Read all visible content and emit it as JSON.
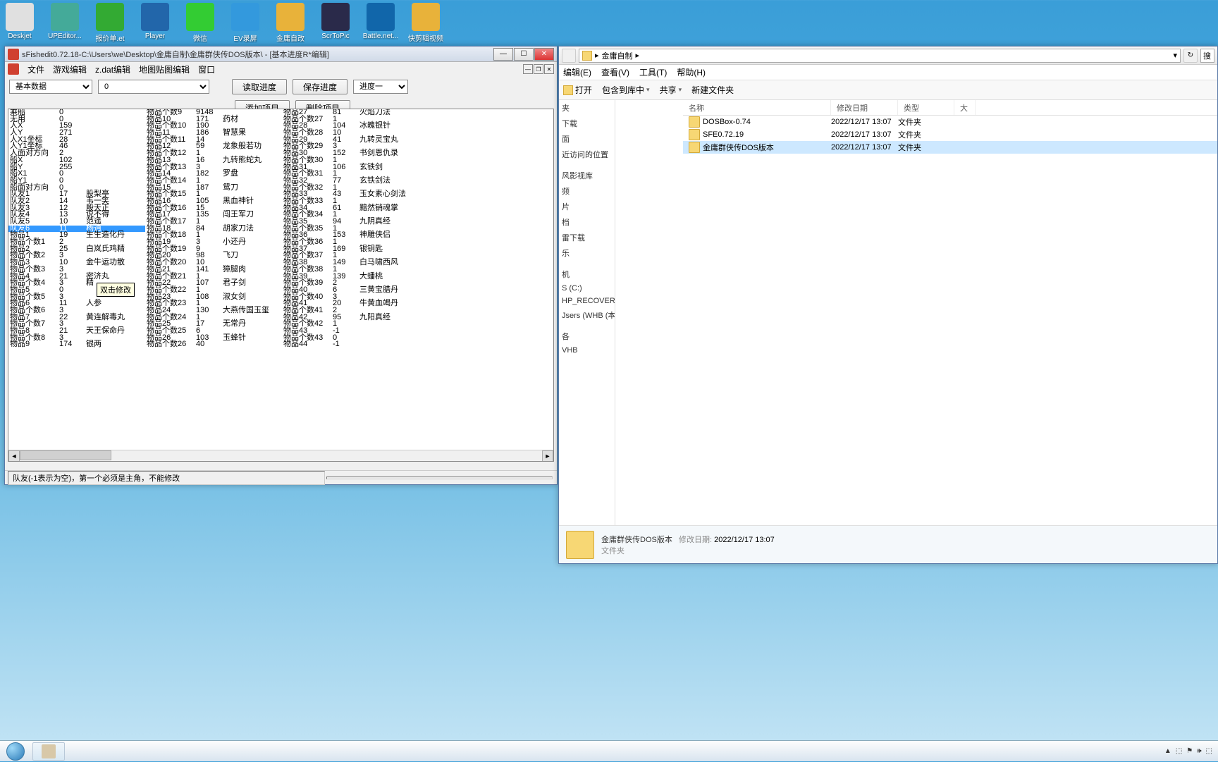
{
  "desktop": {
    "icons": [
      {
        "label": "Deskjet",
        "color": "#e0e0e0"
      },
      {
        "label": "UPEditor...",
        "color": "#4a9"
      },
      {
        "label": "报价单.et",
        "color": "#3a3"
      },
      {
        "label": "Player",
        "color": "#26a"
      },
      {
        "label": "微信",
        "color": "#3c3"
      },
      {
        "label": "EV录屏",
        "color": "#39d"
      },
      {
        "label": "金庸自改",
        "color": "#e8b23a"
      },
      {
        "label": "ScrToPic",
        "color": "#2a2a4a"
      },
      {
        "label": "Battle.net...",
        "color": "#16a"
      },
      {
        "label": "快剪辑视频",
        "color": "#e8b23a"
      }
    ]
  },
  "editor": {
    "title": "sFishedit0.72.18-C:\\Users\\we\\Desktop\\金庸自制\\金庸群侠传DOS版本\\ - [基本进度R*编辑]",
    "menu": [
      "文件",
      "游戏编辑",
      "z.dat编辑",
      "地图贴图编辑",
      "窗口"
    ],
    "combo1": "基本数据",
    "combo2": "0",
    "btn_read": "读取进度",
    "btn_save": "保存进度",
    "combo_progress": "进度一",
    "btn_add": "添加项目",
    "btn_del": "删除项目",
    "status": "队友(-1表示为空)，第一个必须是主角，不能修改",
    "tooltip": "双击修改",
    "columns": {
      "g1": [
        {
          "l": "乘船",
          "v": "0"
        },
        {
          "l": "无用",
          "v": "0"
        },
        {
          "l": "人X",
          "v": "159"
        },
        {
          "l": "人Y",
          "v": "271"
        },
        {
          "l": "人X1坐标",
          "v": "28"
        },
        {
          "l": "人Y1坐标",
          "v": "46"
        },
        {
          "l": "人面对方向",
          "v": "2"
        },
        {
          "l": "船X",
          "v": "102"
        },
        {
          "l": "船Y",
          "v": "255"
        },
        {
          "l": "船X1",
          "v": "0"
        },
        {
          "l": "船Y1",
          "v": "0"
        },
        {
          "l": "船面对方向",
          "v": "0"
        },
        {
          "l": "队友1",
          "v": "17",
          "n": "股梨亭"
        },
        {
          "l": "队友2",
          "v": "14",
          "n": "韦一笑"
        },
        {
          "l": "队友3",
          "v": "12",
          "n": "殷天正"
        },
        {
          "l": "队友4",
          "v": "13",
          "n": "说不得"
        },
        {
          "l": "队友5",
          "v": "10",
          "n": "范遥"
        },
        {
          "l": "队友6",
          "v": "11",
          "n": "杨逍",
          "sel": true
        },
        {
          "l": "物品1",
          "v": "19",
          "n": "生生造化丹"
        },
        {
          "l": "物品个数1",
          "v": "2"
        },
        {
          "l": "物品2",
          "v": "25",
          "n": "白岚氏鸡精"
        },
        {
          "l": "物品个数2",
          "v": "3"
        },
        {
          "l": "物品3",
          "v": "10",
          "n": "金牛运功散"
        },
        {
          "l": "物品个数3",
          "v": "3"
        },
        {
          "l": "物品4",
          "v": "21",
          "n": "密济丸"
        },
        {
          "l": "物品个数4",
          "v": "3",
          "n": "精"
        },
        {
          "l": "物品5",
          "v": "0"
        },
        {
          "l": "物品个数5",
          "v": "3"
        },
        {
          "l": "物品6",
          "v": "11",
          "n": "人参"
        },
        {
          "l": "物品个数6",
          "v": "3"
        },
        {
          "l": "物品7",
          "v": "22",
          "n": "黄连解毒丸"
        },
        {
          "l": "物品个数7",
          "v": "3"
        },
        {
          "l": "物品8",
          "v": "21",
          "n": "天王保命丹"
        },
        {
          "l": "物品个数8",
          "v": "3"
        },
        {
          "l": "物品9",
          "v": "174",
          "n": "银两"
        }
      ],
      "g2": [
        {
          "l": "物品个数9",
          "v": "9148"
        },
        {
          "l": "物品10",
          "v": "171",
          "n": "药材"
        },
        {
          "l": "物品个数10",
          "v": "190"
        },
        {
          "l": "物品11",
          "v": "186",
          "n": "智慧果"
        },
        {
          "l": "物品个数11",
          "v": "14"
        },
        {
          "l": "物品12",
          "v": "59",
          "n": "龙象般若功"
        },
        {
          "l": "物品个数12",
          "v": "1"
        },
        {
          "l": "物品13",
          "v": "16",
          "n": "九转熊蛇丸"
        },
        {
          "l": "物品个数13",
          "v": "3"
        },
        {
          "l": "物品14",
          "v": "182",
          "n": "罗盘"
        },
        {
          "l": "物品个数14",
          "v": "1"
        },
        {
          "l": "物品15",
          "v": "187",
          "n": "鸳刀"
        },
        {
          "l": "物品个数15",
          "v": "1"
        },
        {
          "l": "物品16",
          "v": "105",
          "n": "黑血神针"
        },
        {
          "l": "物品个数16",
          "v": "15"
        },
        {
          "l": "物品17",
          "v": "135",
          "n": "闯王军刀"
        },
        {
          "l": "物品个数17",
          "v": "1"
        },
        {
          "l": "物品18",
          "v": "84",
          "n": "胡家刀法"
        },
        {
          "l": "物品个数18",
          "v": "1"
        },
        {
          "l": "物品19",
          "v": "3",
          "n": "小还丹"
        },
        {
          "l": "物品个数19",
          "v": "9"
        },
        {
          "l": "物品20",
          "v": "98",
          "n": "飞刀"
        },
        {
          "l": "物品个数20",
          "v": "10"
        },
        {
          "l": "物品21",
          "v": "141",
          "n": "獐腿肉"
        },
        {
          "l": "物品个数21",
          "v": "1"
        },
        {
          "l": "物品22",
          "v": "107",
          "n": "君子剑"
        },
        {
          "l": "物品个数22",
          "v": "1"
        },
        {
          "l": "物品23",
          "v": "108",
          "n": "淑女剑"
        },
        {
          "l": "物品个数23",
          "v": "1"
        },
        {
          "l": "物品24",
          "v": "130",
          "n": "大燕传国玉玺"
        },
        {
          "l": "物品个数24",
          "v": "1"
        },
        {
          "l": "物品25",
          "v": "17",
          "n": "无常丹"
        },
        {
          "l": "物品个数25",
          "v": "6"
        },
        {
          "l": "物品26",
          "v": "103",
          "n": "玉蜂针"
        },
        {
          "l": "物品个数26",
          "v": "40"
        }
      ],
      "g3": [
        {
          "l": "物品27",
          "v": "81",
          "n": "火焰刀法"
        },
        {
          "l": "物品个数27",
          "v": "1"
        },
        {
          "l": "物品28",
          "v": "104",
          "n": "冰魄银针"
        },
        {
          "l": "物品个数28",
          "v": "10"
        },
        {
          "l": "物品29",
          "v": "41",
          "n": "九转灵宝丸"
        },
        {
          "l": "物品个数29",
          "v": "3"
        },
        {
          "l": "物品30",
          "v": "152",
          "n": "书剑恩仇录"
        },
        {
          "l": "物品个数30",
          "v": "1"
        },
        {
          "l": "物品31",
          "v": "106",
          "n": "玄铁剑"
        },
        {
          "l": "物品个数31",
          "v": "1"
        },
        {
          "l": "物品32",
          "v": "77",
          "n": "玄铁剑法"
        },
        {
          "l": "物品个数32",
          "v": "1"
        },
        {
          "l": "物品33",
          "v": "43",
          "n": "玉女素心剑法"
        },
        {
          "l": "物品个数33",
          "v": "1"
        },
        {
          "l": "物品34",
          "v": "61",
          "n": "黯然销魂掌"
        },
        {
          "l": "物品个数34",
          "v": "1"
        },
        {
          "l": "物品35",
          "v": "94",
          "n": "九阴真经"
        },
        {
          "l": "物品个数35",
          "v": "1"
        },
        {
          "l": "物品36",
          "v": "153",
          "n": "神雕侠侣"
        },
        {
          "l": "物品个数36",
          "v": "1"
        },
        {
          "l": "物品37",
          "v": "169",
          "n": "银钥匙"
        },
        {
          "l": "物品个数37",
          "v": "1"
        },
        {
          "l": "物品38",
          "v": "149",
          "n": "白马啸西风"
        },
        {
          "l": "物品个数38",
          "v": "1"
        },
        {
          "l": "物品39",
          "v": "139",
          "n": "大蟠桃"
        },
        {
          "l": "物品个数39",
          "v": "2"
        },
        {
          "l": "物品40",
          "v": "6",
          "n": "三黄宝腊丹"
        },
        {
          "l": "物品个数40",
          "v": "3"
        },
        {
          "l": "物品41",
          "v": "20",
          "n": "牛黄血竭丹"
        },
        {
          "l": "物品个数41",
          "v": "2"
        },
        {
          "l": "物品42",
          "v": "95",
          "n": "九阳真经"
        },
        {
          "l": "物品个数42",
          "v": "1"
        },
        {
          "l": "物品43",
          "v": "-1"
        },
        {
          "l": "物品个数43",
          "v": "0"
        },
        {
          "l": "物品44",
          "v": "-1"
        }
      ]
    }
  },
  "explorer": {
    "path_folder": "金庸自制",
    "search_placeholder": "搜",
    "menu": [
      "编辑(E)",
      "查看(V)",
      "工具(T)",
      "帮助(H)"
    ],
    "toolbar": {
      "open": "打开",
      "include": "包含到库中",
      "share": "共享",
      "newfolder": "新建文件夹"
    },
    "headers": {
      "name": "名称",
      "date": "修改日期",
      "type": "类型",
      "size": "大"
    },
    "nav": [
      "夹",
      "下载",
      "面",
      "近访问的位置",
      "",
      "风影视库",
      "频",
      "片",
      "档",
      "雷下载",
      "乐",
      "",
      "机",
      "S (C:)",
      "HP_RECOVERY (D:)",
      "Jsers (WHB (本机))",
      "",
      "各",
      "VHB"
    ],
    "files": [
      {
        "name": "DOSBox-0.74",
        "date": "2022/12/17 13:07",
        "type": "文件夹"
      },
      {
        "name": "SFE0.72.19",
        "date": "2022/12/17 13:07",
        "type": "文件夹"
      },
      {
        "name": "金庸群侠传DOS版本",
        "date": "2022/12/17 13:07",
        "type": "文件夹"
      }
    ],
    "details": {
      "name": "金庸群侠传DOS版本",
      "meta_label": "修改日期:",
      "meta_val": "2022/12/17 13:07",
      "type": "文件夹"
    }
  }
}
